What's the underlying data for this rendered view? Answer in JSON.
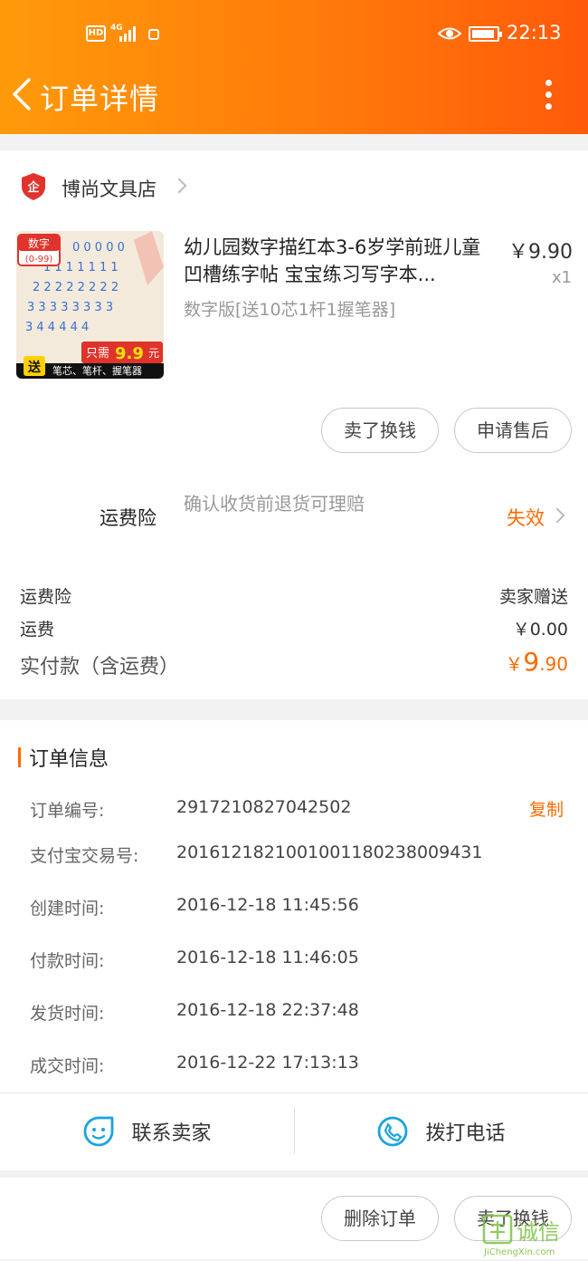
{
  "status_bar": {
    "hd": "HD",
    "network": "4G",
    "time": "22:13"
  },
  "header": {
    "title": "订单详情"
  },
  "shop": {
    "logo_text": "企",
    "name": "博尚文具店"
  },
  "product": {
    "title": "幼儿园数字描红本3-6岁学前班儿童凹槽练字帖 宝宝练习写字本...",
    "sku": "数字版[送10芯1杆1握笔器]",
    "price": "￥9.90",
    "qty": "x1",
    "img": {
      "tag": "数字",
      "range": "(0-99)",
      "only": "只需",
      "only_price": "9.9",
      "only_unit": "元",
      "gift": "送",
      "gift_items": "笔芯、笔杆、握笔器"
    }
  },
  "item_actions": {
    "sell_label": "卖了换钱",
    "aftersale_label": "申请售后"
  },
  "insurance": {
    "label": "运费险",
    "desc": "确认收货前退货可理赔",
    "status": "失效"
  },
  "summary": {
    "rows": [
      {
        "label": "运费险",
        "value": "卖家赠送"
      },
      {
        "label": "运费",
        "value": "￥0.00"
      }
    ],
    "total_label": "实付款（含运费）",
    "total_symbol": "￥",
    "total_int": "9",
    "total_dec": ".90"
  },
  "order_info": {
    "title": "订单信息",
    "copy_label": "复制",
    "items": [
      {
        "label": "订单编号:",
        "value": "2917210827042502"
      },
      {
        "label": "支付宝交易号:",
        "value": "2016121821001001180238009431"
      },
      {
        "label": "创建时间:",
        "value": "2016-12-18 11:45:56"
      },
      {
        "label": "付款时间:",
        "value": "2016-12-18 11:46:05"
      },
      {
        "label": "发货时间:",
        "value": "2016-12-18 22:37:48"
      },
      {
        "label": "成交时间:",
        "value": "2016-12-22 17:13:13"
      }
    ]
  },
  "contact": {
    "seller_label": "联系卖家",
    "call_label": "拨打电话"
  },
  "bottom_actions": {
    "delete_label": "删除订单",
    "sell_label": "卖了换钱"
  },
  "watermark": {
    "brand": "诚信",
    "site": "JiChengXin.com"
  },
  "colors": {
    "accent": "#ff6a00",
    "header_start": "#ff9a0a",
    "header_end": "#ff5a0a",
    "icon_blue": "#1aa3e0"
  }
}
